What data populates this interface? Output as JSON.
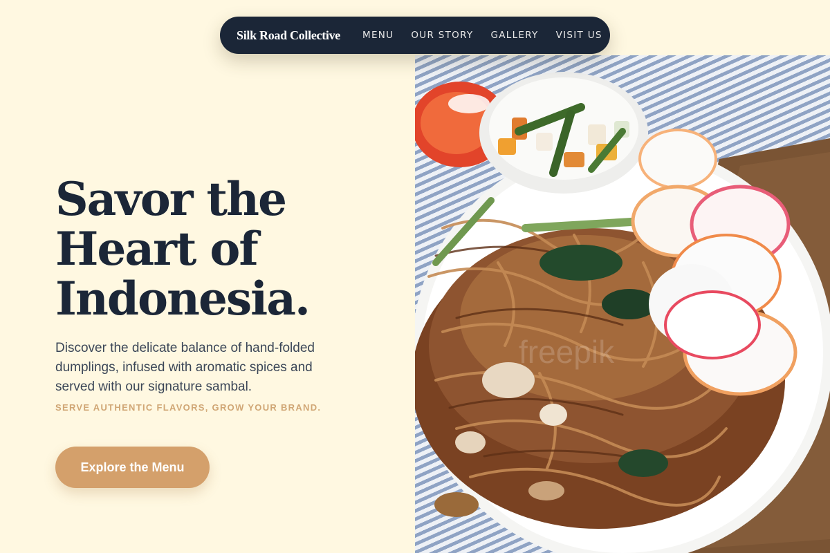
{
  "nav": {
    "brand": "Silk Road Collective",
    "links": [
      "MENU",
      "OUR STORY",
      "GALLERY",
      "VISIT US"
    ]
  },
  "hero": {
    "title_lines": [
      "Savor the",
      "Heart of",
      "Indonesia."
    ],
    "description": "Discover the delicate balance of hand-folded dumplings, infused with aromatic spices and served with our signature sambal.",
    "tagline": "SERVE AUTHENTIC FLAVORS, GROW YOUR BRAND.",
    "cta_label": "Explore the Menu"
  },
  "image": {
    "subject": "Indonesian fried noodles (mie goreng) with pickles, tomato and prawn crackers on a white plate",
    "watermark": "freepik"
  },
  "colors": {
    "background": "#fff8e1",
    "navy": "#1b2637",
    "accent": "#d4a06b",
    "tagline": "#d0a675"
  }
}
